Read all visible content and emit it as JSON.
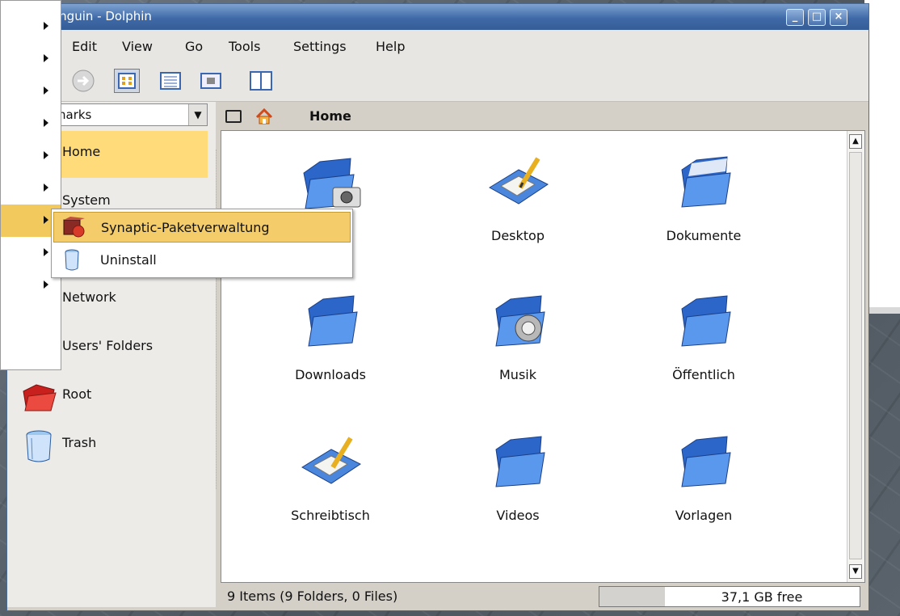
{
  "window": {
    "title": "inguin - Dolphin",
    "buttons": [
      "_",
      "□",
      "×"
    ]
  },
  "menubar": {
    "items": [
      {
        "label": "Edit"
      },
      {
        "label": "View"
      },
      {
        "label": "Go"
      },
      {
        "label": "Tools"
      },
      {
        "label": "Settings"
      },
      {
        "label": "Help"
      }
    ]
  },
  "toolbar": {
    "buttons": [
      "forward-icon",
      "icons-view-icon",
      "details-view-icon",
      "preview-icon",
      "split-view-icon"
    ]
  },
  "panel": {
    "combo_text": "narks",
    "places": [
      {
        "label": "Home",
        "icon": "home-folder-icon",
        "selected": true
      },
      {
        "label": "System",
        "icon": "system-icon",
        "selected": false
      },
      {
        "label": "Network",
        "icon": "network-icon",
        "selected": false
      },
      {
        "label": "Users' Folders",
        "icon": "users-folder-icon",
        "selected": false
      },
      {
        "label": "Root",
        "icon": "root-folder-icon",
        "selected": false
      },
      {
        "label": "Trash",
        "icon": "trash-icon",
        "selected": false
      }
    ]
  },
  "location": {
    "label": "Home"
  },
  "files": [
    {
      "label": "",
      "icon": "camera-folder-icon"
    },
    {
      "label": "Desktop",
      "icon": "desktop-folder-icon"
    },
    {
      "label": "Dokumente",
      "icon": "folder-icon"
    },
    {
      "label": "Downloads",
      "icon": "folder-icon"
    },
    {
      "label": "Musik",
      "icon": "music-folder-icon"
    },
    {
      "label": "Öffentlich",
      "icon": "folder-icon"
    },
    {
      "label": "Schreibtisch",
      "icon": "desktop-folder-icon"
    },
    {
      "label": "Videos",
      "icon": "folder-icon"
    },
    {
      "label": "Vorlagen",
      "icon": "folder-icon"
    }
  ],
  "statusbar": {
    "items_text": "9 Items (9 Folders, 0 Files)",
    "free_text": "37,1 GB free",
    "free_fraction_used": 0.25
  },
  "kmenu": {
    "item_count": 9,
    "highlighted_index": 6
  },
  "submenu": {
    "items": [
      {
        "label": "Synaptic-Paketverwaltung",
        "icon": "synaptic-icon",
        "highlighted": true
      },
      {
        "label": "Uninstall",
        "icon": "uninstall-icon",
        "highlighted": false
      }
    ]
  },
  "colors": {
    "selection": "#ffdb7a",
    "titlebar": "#3f6aa7",
    "folder_blue": "#3f7fe0"
  }
}
